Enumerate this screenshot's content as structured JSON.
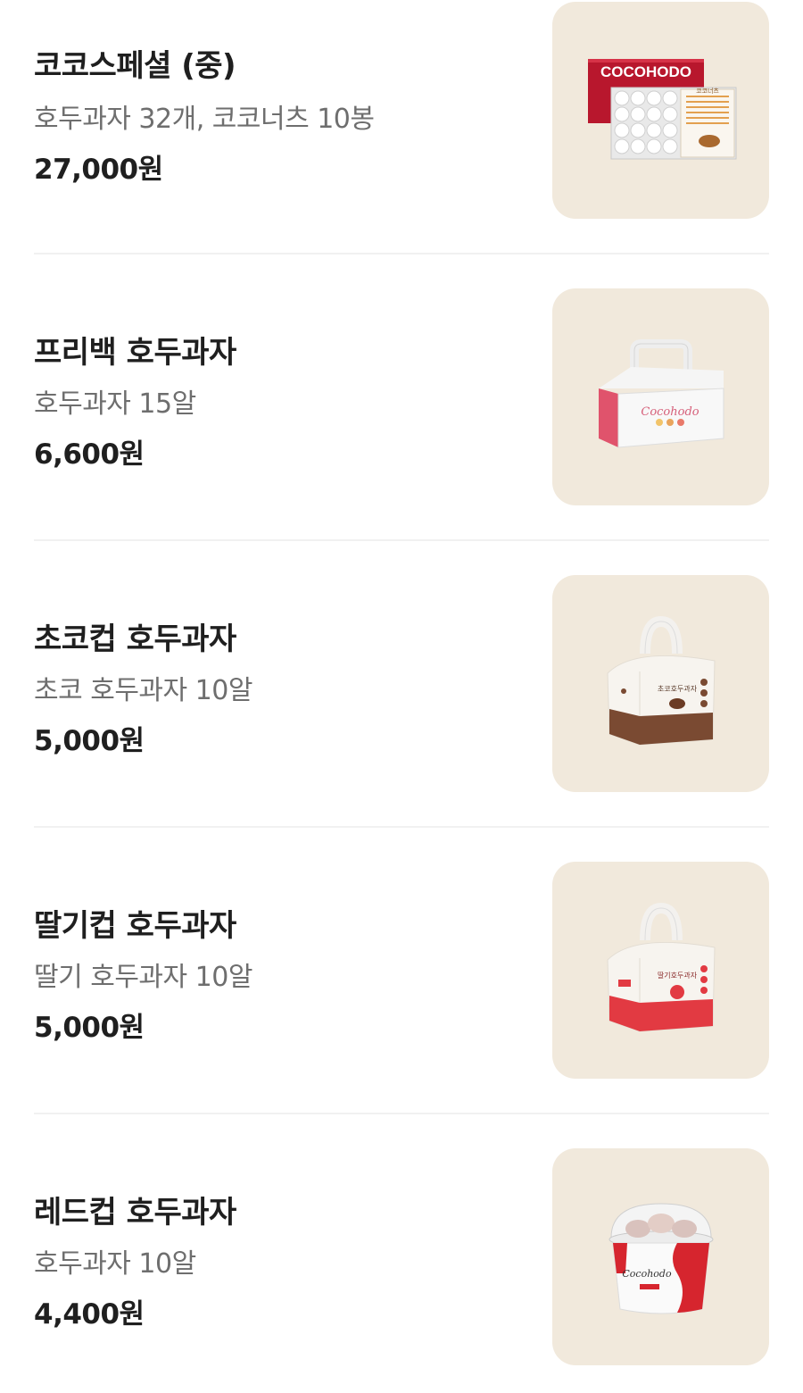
{
  "menu": {
    "items": [
      {
        "name": "코코스페셜 (중)",
        "description": "호두과자 32개, 코코너츠 10봉",
        "price": "27,000원",
        "image_icon": "cocohodo-gift-box-icon",
        "image_text": {
          "brand": "COCOHODO",
          "pack_label": "코코너츠"
        }
      },
      {
        "name": "프리백 호두과자",
        "description": "호두과자 15알",
        "price": "6,600원",
        "image_icon": "handle-box-icon",
        "image_text": {
          "brand": "Cocohodo"
        }
      },
      {
        "name": "초코컵 호두과자",
        "description": "초코 호두과자 10알",
        "price": "5,000원",
        "image_icon": "choco-cup-box-icon",
        "image_text": {
          "label": "초코호두과자"
        }
      },
      {
        "name": "딸기컵 호두과자",
        "description": "딸기 호두과자 10알",
        "price": "5,000원",
        "image_icon": "strawberry-cup-box-icon",
        "image_text": {
          "label": "딸기호두과자"
        }
      },
      {
        "name": "레드컵 호두과자",
        "description": "호두과자 10알",
        "price": "4,400원",
        "image_icon": "red-cup-icon",
        "image_text": {
          "brand": "Cocohodo"
        }
      }
    ]
  },
  "colors": {
    "thumb_bg": "#f1e9dc",
    "brand_red": "#c8102e",
    "choco_brown": "#7a4a32",
    "text_primary": "#1f1f1f",
    "text_secondary": "#6e6e6e",
    "divider": "#f1f1f1"
  }
}
